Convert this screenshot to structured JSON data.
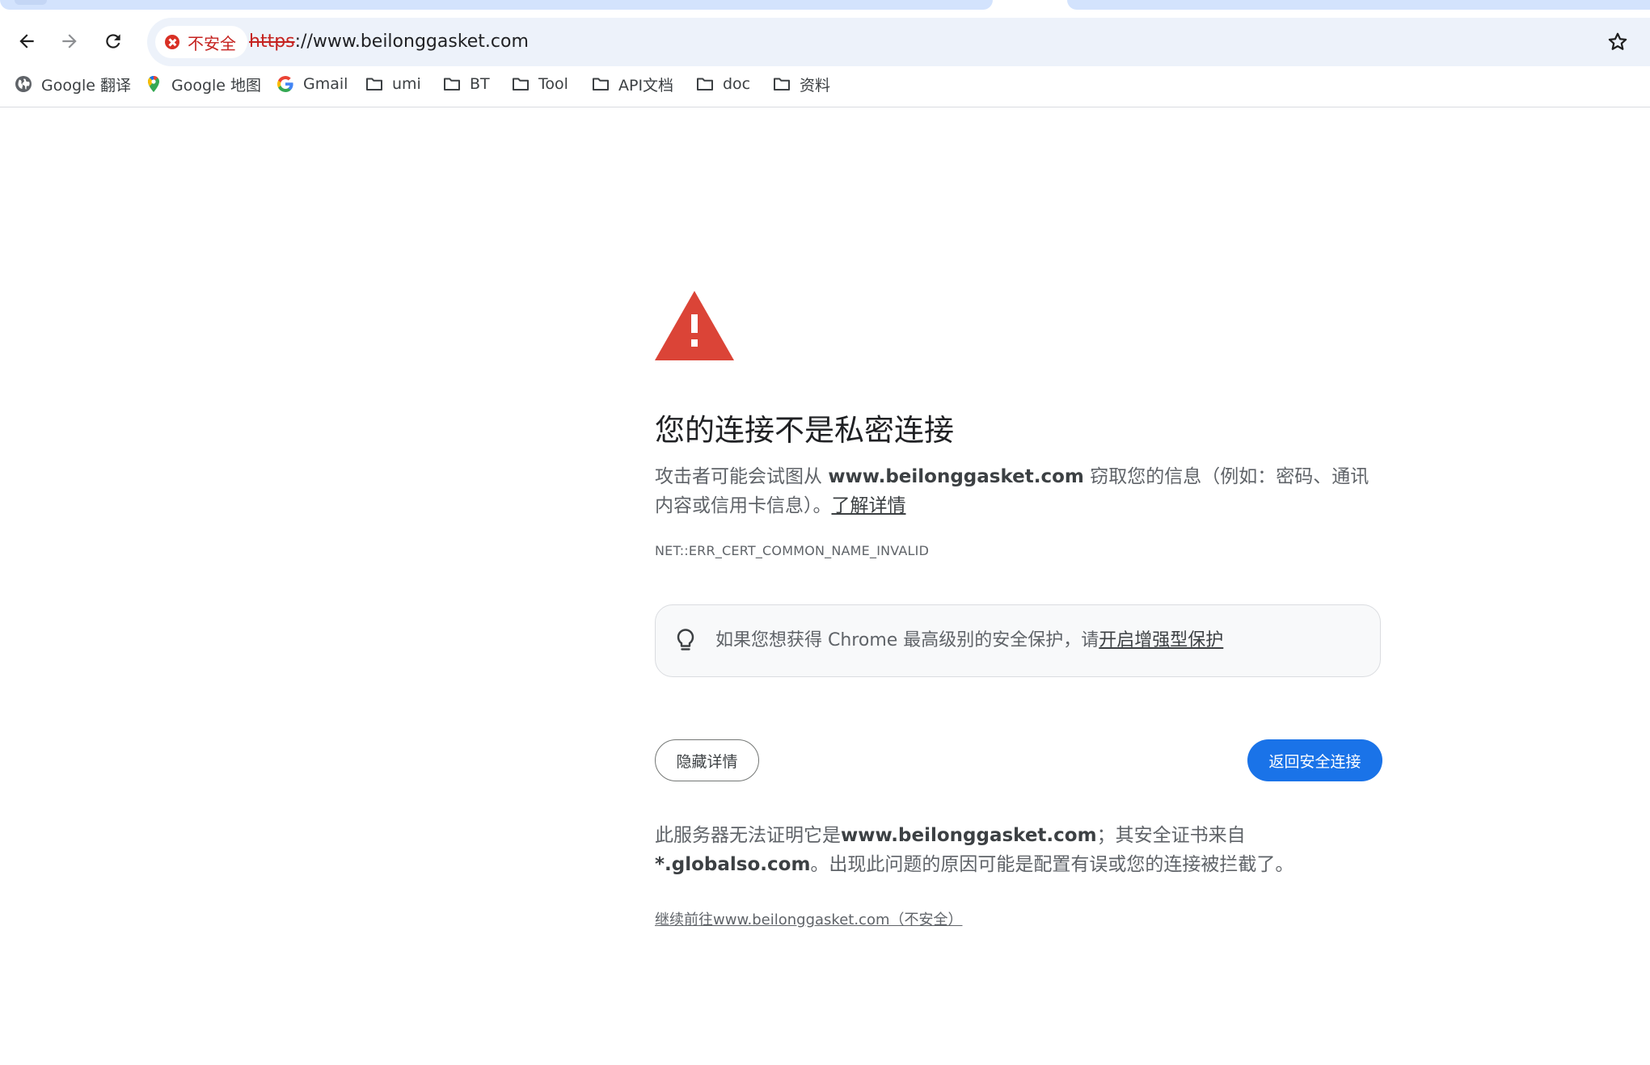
{
  "browser": {
    "security_chip": "不安全",
    "url_scheme": "https",
    "url_rest": "://www.beilonggasket.com"
  },
  "bookmarks": [
    {
      "label": "Google 翻译",
      "icon": "globe-icon"
    },
    {
      "label": "Google 地图",
      "icon": "maps-pin-icon"
    },
    {
      "label": "Gmail",
      "icon": "google-g-icon"
    },
    {
      "label": "umi",
      "icon": "folder-icon"
    },
    {
      "label": "BT",
      "icon": "folder-icon"
    },
    {
      "label": "Tool",
      "icon": "folder-icon"
    },
    {
      "label": "API文档",
      "icon": "folder-icon"
    },
    {
      "label": "doc",
      "icon": "folder-icon"
    },
    {
      "label": "资料",
      "icon": "folder-icon"
    }
  ],
  "interstitial": {
    "heading": "您的连接不是私密连接",
    "desc_pre": "攻击者可能会试图从 ",
    "desc_host": "www.beilonggasket.com",
    "desc_post": " 窃取您的信息（例如：密码、通讯内容或信用卡信息）。",
    "learn_more": "了解详情",
    "error_code": "NET::ERR_CERT_COMMON_NAME_INVALID",
    "callout_text": "如果您想获得 Chrome 最高级别的安全保护，请",
    "callout_link": "开启增强型保护",
    "hide_details": "隐藏详情",
    "back_to_safety": "返回安全连接",
    "details_pre": "此服务器无法证明它是",
    "details_host": "www.beilonggasket.com",
    "details_mid": "；其安全证书来自",
    "details_cert": "*.globalso.com",
    "details_post": "。出现此问题的原因可能是配置有误或您的连接被拦截了。",
    "proceed_link": "继续前往www.beilonggasket.com（不安全）"
  },
  "colors": {
    "accent": "#1a73e8",
    "danger": "#d93025",
    "omnibox_bg": "#edf2fa"
  }
}
